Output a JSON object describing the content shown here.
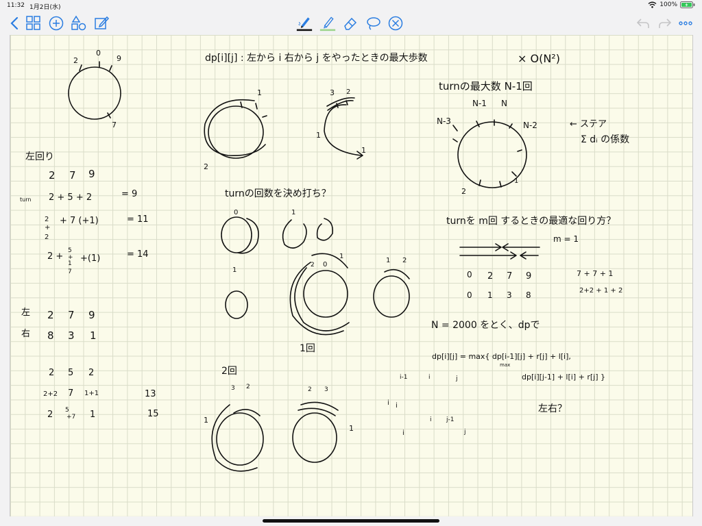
{
  "status": {
    "time": "11:32",
    "date": "1月2日(水)",
    "battery": "100%"
  },
  "toolbar": {
    "left_icons": [
      "back-chevron-icon",
      "thumbnails-grid-icon",
      "add-page-icon",
      "shapes-icon",
      "edit-icon"
    ],
    "center_tools": [
      "pen-tool",
      "highlighter-tool",
      "eraser-tool",
      "lasso-tool",
      "hide-toolbar"
    ],
    "right_icons": [
      "undo-icon",
      "redo-icon",
      "more-icon"
    ],
    "pen_color": "#111111",
    "highlighter_color": "#9dd48c"
  },
  "notes": {
    "left": {
      "circle_labels": [
        "2",
        "0",
        "9",
        "7"
      ],
      "section_title": "左回り",
      "row_header": [
        "2",
        "7",
        "9"
      ],
      "turn_label": "turn",
      "row1": "2 + 5 + 2",
      "row1_result": "= 9",
      "row2_a": "2",
      "row2_b": "+",
      "row2_c": "2",
      "row2_rest": "+ 7 (+1)",
      "row2_result": "= 11",
      "row3_a": "2 +",
      "row3_b": "5",
      "row3_c": "+",
      "row3_d": "1",
      "row3_e": "7",
      "row3_rest": "+(1)",
      "row3_result": "= 14",
      "left_label": "左",
      "left_vals": [
        "2",
        "7",
        "9"
      ],
      "right_label": "右",
      "right_vals": [
        "8",
        "3",
        "1"
      ],
      "t2_head": [
        "2",
        "5",
        "2"
      ],
      "t2_r1": [
        "2+2",
        "7",
        "1+1"
      ],
      "t2_r1_res": "13",
      "t2_r2_a": "2",
      "t2_r2_b": "5",
      "t2_r2_c": "+7",
      "t2_r2_d": "1",
      "t2_r2_res": "15"
    },
    "center": {
      "dp_title": "dp[i][j] : 左から i 右から j をやったときの最大歩数",
      "complexity": "× O(N²)",
      "c1_labels": [
        "1",
        "2"
      ],
      "c2_labels": [
        "3",
        "2",
        "1",
        "1"
      ],
      "turn_fix": "turnの回数を決め打ち？",
      "mid_labels": [
        "0",
        "1",
        "1"
      ],
      "big_labels": [
        "2",
        "0",
        "1"
      ],
      "small_labels": [
        "1",
        "2"
      ],
      "once": "1回",
      "twice": "2回",
      "b1_labels": [
        "3",
        "2",
        "1"
      ],
      "b2_labels": [
        "2",
        "3",
        "1"
      ]
    },
    "right": {
      "turn_max": "turnの最大数 N-1回",
      "ring_labels": [
        "N-1",
        "N",
        "N-3",
        "N-2",
        "2",
        "1"
      ],
      "sum_note": "← ステア",
      "sum_formula": "Σ dᵢ の係数",
      "turn_m": "turnを m回 するときの最適な回り方？",
      "m_eq": "m = 1",
      "seq1": [
        "0",
        "2",
        "7",
        "9"
      ],
      "seq2": [
        "0",
        "1",
        "3",
        "8"
      ],
      "calc1": "7 + 7 + 1",
      "calc2": "2+2 + 1 + 2",
      "n2000": "N = 2000 をとく、dpで",
      "dp_eq1": "dp[i][j] = max{ dp[i-1][j] + r[j] + l[i],",
      "dp_max": "max",
      "dp_eq2": "dp[i][j-1] + l[i] + r[j] }",
      "idx_a": [
        "i-1",
        "i",
        "j"
      ],
      "idx_b": [
        "i",
        "i"
      ],
      "idx_c": [
        "i",
        "j-1"
      ],
      "idx_d": [
        "i",
        "j"
      ],
      "lr_question": "左右？"
    }
  }
}
